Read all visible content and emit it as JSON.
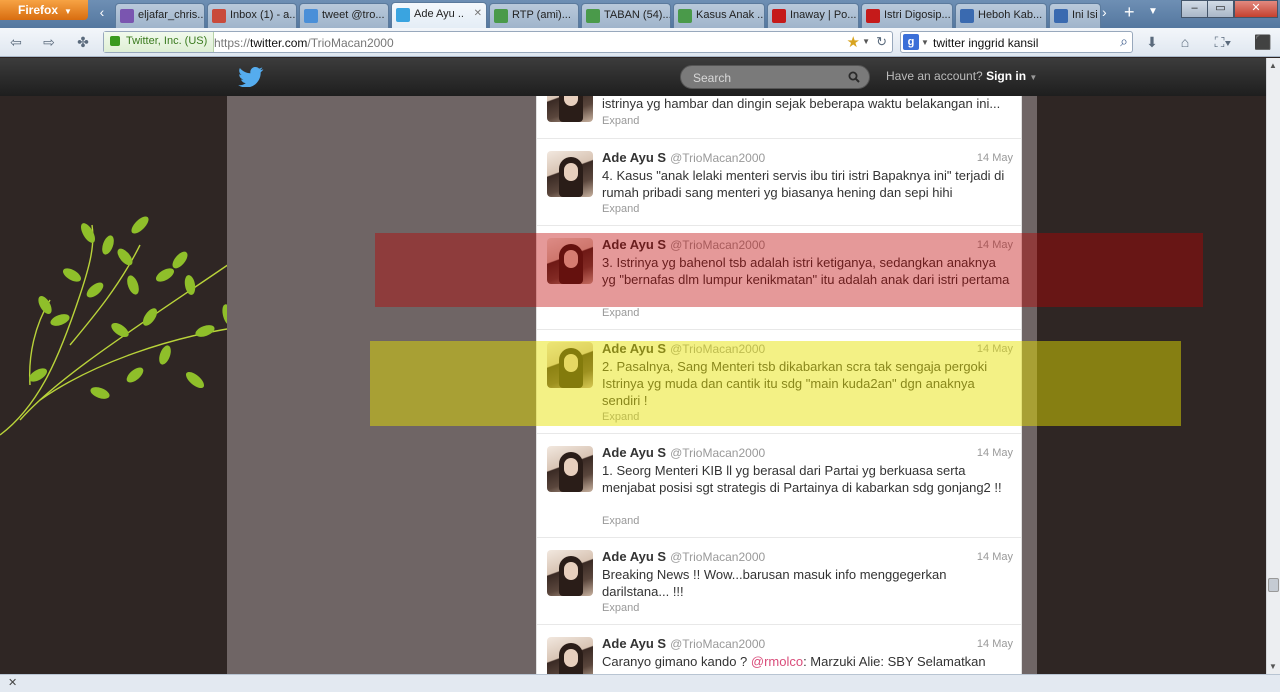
{
  "browser": {
    "app_button": "Firefox",
    "tabs": [
      {
        "label": "eljafar_chris...",
        "icon_color": "#7a55b0"
      },
      {
        "label": "Inbox (1) - a...",
        "icon_color": "#c94a3b"
      },
      {
        "label": "tweet @tro...",
        "icon_color": "#4a8fd8"
      },
      {
        "label": "Ade Ayu ...",
        "icon_color": "#3aa4e0",
        "active": true
      },
      {
        "label": "RTP (ami)...",
        "icon_color": "#4a9a4a"
      },
      {
        "label": "TABAN (54)...",
        "icon_color": "#4a9a4a"
      },
      {
        "label": "Kasus Anak ...",
        "icon_color": "#4a9a4a"
      },
      {
        "label": "Inaway | Po...",
        "icon_color": "#c51a1a"
      },
      {
        "label": "Istri Digosip...",
        "icon_color": "#c51a1a"
      },
      {
        "label": "Heboh Kab...",
        "icon_color": "#3a6ab0"
      },
      {
        "label": "Ini Isi",
        "icon_color": "#3a6ab0"
      }
    ],
    "site_identity": "Twitter, Inc. (US)",
    "url_prefix": "https://",
    "url_host": "twitter.com",
    "url_path": "/TrioMacan2000",
    "search_value": "twitter inggrid kansil",
    "search_engine_icon": "google-icon"
  },
  "twitter": {
    "search_placeholder": "Search",
    "have_account": "Have an account?",
    "sign_in": "Sign in"
  },
  "tweets": [
    {
      "name": "",
      "handle": "",
      "time": "",
      "text": "istrinya yg hambar dan dingin sejak beberapa waktu belakangan ini...",
      "expand": "Expand"
    },
    {
      "name": "Ade Ayu S",
      "handle": "@TrioMacan2000",
      "time": "14 May",
      "text": "4. Kasus \"anak lelaki menteri servis ibu tiri istri Bapaknya ini\" terjadi di rumah pribadi sang menteri yg biasanya hening dan sepi hihi",
      "expand": "Expand"
    },
    {
      "name": "Ade Ayu S",
      "handle": "@TrioMacan2000",
      "time": "14 May",
      "text": "3. Istrinya yg bahenol tsb adalah istri ketiganya, sedangkan anaknya yg \"bernafas dlm lumpur kenikmatan\" itu adalah anak dari istri pertama",
      "expand": "Expand"
    },
    {
      "name": "Ade Ayu S",
      "handle": "@TrioMacan2000",
      "time": "14 May",
      "text": "2. Pasalnya, Sang Menteri tsb dikabarkan scra tak sengaja pergoki Istrinya yg muda dan cantik itu sdg \"main kuda2an\" dgn anaknya sendiri !",
      "expand": "Expand"
    },
    {
      "name": "Ade Ayu S",
      "handle": "@TrioMacan2000",
      "time": "14 May",
      "text": "1. Seorg  Menteri KIB ll yg berasal dari Partai yg berkuasa serta menjabat posisi sgt strategis di Partainya di kabarkan sdg gonjang2 !!",
      "expand": "Expand"
    },
    {
      "name": "Ade Ayu S",
      "handle": "@TrioMacan2000",
      "time": "14 May",
      "text": "Breaking News !! Wow...barusan masuk info menggegerkan darilstana... !!!",
      "expand": "Expand"
    },
    {
      "name": "Ade Ayu S",
      "handle": "@TrioMacan2000",
      "time": "14 May",
      "text_before": "Caranyo gimano kando ? ",
      "mention": "@rmolco",
      "text_after": ": Marzuki Alie: SBY Selamatkan"
    }
  ],
  "colors": {
    "highlight_red": "#be0000",
    "highlight_yellow": "#e6e100",
    "mention": "#d94c7a"
  }
}
